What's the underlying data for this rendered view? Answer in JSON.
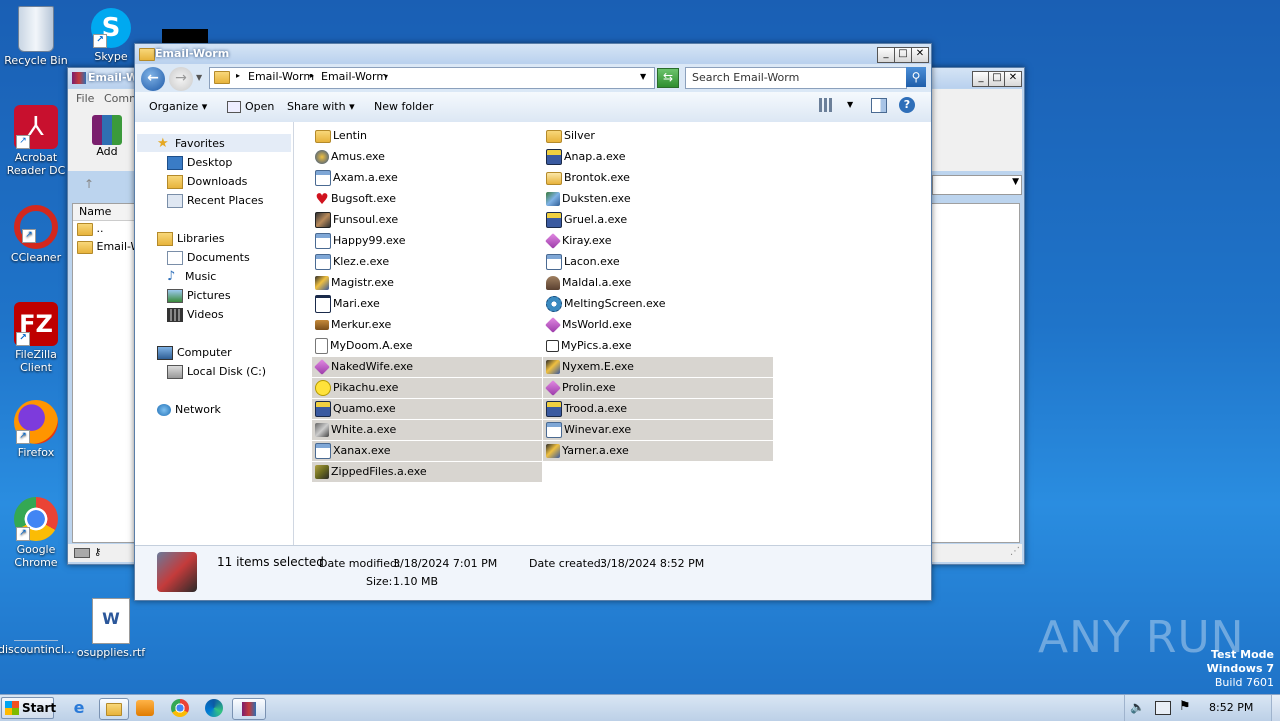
{
  "desktop": {
    "icons": [
      {
        "label": "Recycle Bin"
      },
      {
        "label": "Skype"
      },
      {
        "label": "Acrobat Reader DC"
      },
      {
        "label": "CCleaner"
      },
      {
        "label": "FileZilla Client"
      },
      {
        "label": "Firefox"
      },
      {
        "label": "Google Chrome"
      },
      {
        "label": "discountincl..."
      },
      {
        "label": "osupplies.rtf"
      }
    ],
    "watermark": {
      "brand": "ANY RUN",
      "line1": "Test Mode",
      "line2": "Windows 7",
      "line3": "Build 7601"
    }
  },
  "bg_window": {
    "title": "Email-W",
    "menu": [
      "File",
      "Comm"
    ],
    "add_label": "Add",
    "col_name": "Name",
    "rows": [
      "..",
      "Email-W"
    ]
  },
  "explorer": {
    "title": "Email-Worm",
    "breadcrumb": [
      "Email-Worm",
      "Email-Worm"
    ],
    "search_placeholder": "Search Email-Worm",
    "toolbar": {
      "organize": "Organize",
      "open": "Open",
      "share_with": "Share with",
      "new_folder": "New folder"
    },
    "nav": {
      "favorites": "Favorites",
      "desktop": "Desktop",
      "downloads": "Downloads",
      "recent": "Recent Places",
      "libraries": "Libraries",
      "documents": "Documents",
      "music": "Music",
      "pictures": "Pictures",
      "videos": "Videos",
      "computer": "Computer",
      "local_disk": "Local Disk (C:)",
      "network": "Network"
    },
    "files_col1": [
      {
        "name": "Lentin",
        "icon": "folder-icon",
        "sel": false
      },
      {
        "name": "Amus.exe",
        "icon": "app-icon",
        "sel": false
      },
      {
        "name": "Axam.a.exe",
        "icon": "window-icon",
        "sel": false
      },
      {
        "name": "Bugsoft.exe",
        "icon": "heart-icon",
        "sel": false
      },
      {
        "name": "Funsoul.exe",
        "icon": "photo-icon",
        "sel": false
      },
      {
        "name": "Happy99.exe",
        "icon": "window-icon",
        "sel": false
      },
      {
        "name": "Klez.e.exe",
        "icon": "window-icon",
        "sel": false
      },
      {
        "name": "Magistr.exe",
        "icon": "installer-icon",
        "sel": false
      },
      {
        "name": "Mari.exe",
        "icon": "blank-window-icon",
        "sel": false
      },
      {
        "name": "Merkur.exe",
        "icon": "box-icon",
        "sel": false
      },
      {
        "name": "MyDoom.A.exe",
        "icon": "document-icon",
        "sel": false
      },
      {
        "name": "NakedWife.exe",
        "icon": "diamond-icon",
        "sel": true
      },
      {
        "name": "Pikachu.exe",
        "icon": "smiley-icon",
        "sel": true
      },
      {
        "name": "Quamo.exe",
        "icon": "computer-icon",
        "sel": true
      },
      {
        "name": "White.a.exe",
        "icon": "setup-icon",
        "sel": true
      },
      {
        "name": "Xanax.exe",
        "icon": "window-icon",
        "sel": true
      },
      {
        "name": "ZippedFiles.a.exe",
        "icon": "archive-icon",
        "sel": true
      }
    ],
    "files_col2": [
      {
        "name": "Silver",
        "icon": "folder-icon",
        "sel": false
      },
      {
        "name": "Anap.a.exe",
        "icon": "computer-icon",
        "sel": false
      },
      {
        "name": "Brontok.exe",
        "icon": "folder-open-icon",
        "sel": false
      },
      {
        "name": "Duksten.exe",
        "icon": "network-icon",
        "sel": false
      },
      {
        "name": "Gruel.a.exe",
        "icon": "computer-icon",
        "sel": false
      },
      {
        "name": "Kiray.exe",
        "icon": "diamond-icon",
        "sel": false
      },
      {
        "name": "Lacon.exe",
        "icon": "window-icon",
        "sel": false
      },
      {
        "name": "Maldal.a.exe",
        "icon": "figure-icon",
        "sel": false
      },
      {
        "name": "MeltingScreen.exe",
        "icon": "gear-icon",
        "sel": false
      },
      {
        "name": "MsWorld.exe",
        "icon": "diamond-icon",
        "sel": false
      },
      {
        "name": "MyPics.a.exe",
        "icon": "small-window-icon",
        "sel": false
      },
      {
        "name": "Nyxem.E.exe",
        "icon": "installer-icon",
        "sel": true
      },
      {
        "name": "Prolin.exe",
        "icon": "diamond-icon",
        "sel": true
      },
      {
        "name": "Trood.a.exe",
        "icon": "computer-icon",
        "sel": true
      },
      {
        "name": "Winevar.exe",
        "icon": "window-icon",
        "sel": true
      },
      {
        "name": "Yarner.a.exe",
        "icon": "installer-icon",
        "sel": true
      }
    ],
    "details": {
      "selected": "11 items selected",
      "modified_label": "Date modified:",
      "modified": "3/18/2024 7:01 PM",
      "created_label": "Date created:",
      "created": "3/18/2024 8:52 PM",
      "size_label": "Size:",
      "size": "1.10 MB"
    }
  },
  "taskbar": {
    "start": "Start",
    "clock": "8:52 PM"
  },
  "colors": {
    "selection": "#d8d5d0",
    "titlebar": "#b9d1ee",
    "desktop": "#1f74c9"
  }
}
